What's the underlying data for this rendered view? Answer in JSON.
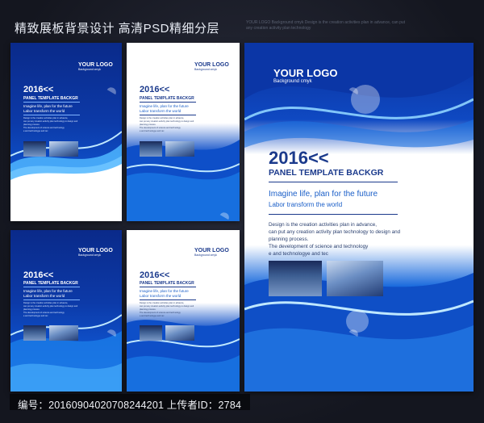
{
  "banner": {
    "title": "精致展板背景设计 高清PSD精细分层",
    "faint_text": "YOUR LOGO Background cmyk Design is the creation activities plan in advance, can put any creation activity plan technology"
  },
  "panel": {
    "logo": "YOUR LOGO",
    "logo_sub": "Background cmyk",
    "year": "2016<<",
    "title": "PANEL TEMPLATE BACKGR",
    "tagline1": "Imagine life, plan for the future",
    "tagline2": "Labor transform the world",
    "body_lines": [
      "Design is the creation activities plan in advance,",
      "can put any creation activity plan technology to design and",
      "planning process.",
      "The development of science and technology",
      "e and technologye and tec"
    ]
  },
  "footer": {
    "text": "编号：20160904020708244201 上传者ID：2784"
  },
  "colors": {
    "navy": "#0a2f9a",
    "blue": "#1768dc",
    "title_blue": "#1b3a8c",
    "background": "#1c1f2b"
  }
}
